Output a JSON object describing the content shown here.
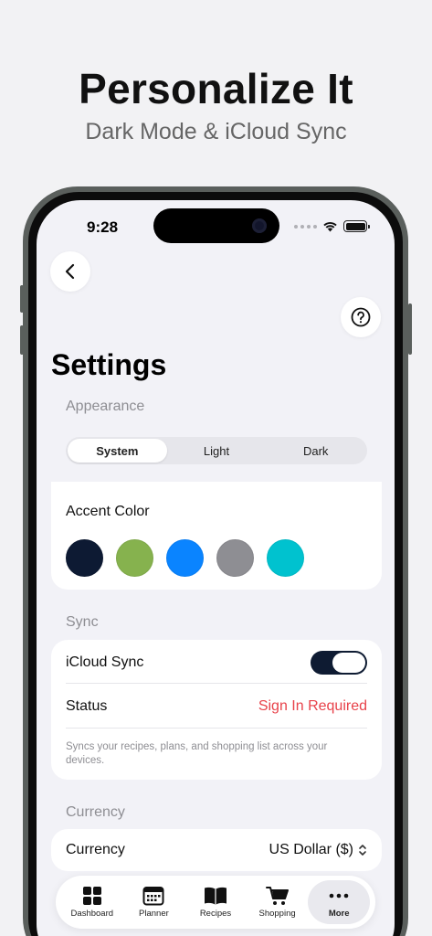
{
  "promo": {
    "title": "Personalize It",
    "subtitle": "Dark Mode & iCloud Sync"
  },
  "status_bar": {
    "time": "9:28"
  },
  "page": {
    "title": "Settings"
  },
  "appearance": {
    "header": "Appearance",
    "options": [
      "System",
      "Light",
      "Dark"
    ],
    "selected": "System"
  },
  "accent": {
    "label": "Accent Color",
    "colors": [
      "#0d1a33",
      "#86b24e",
      "#0a84ff",
      "#8e8e93",
      "#00c2cf"
    ]
  },
  "sync": {
    "header": "Sync",
    "icloud_label": "iCloud Sync",
    "icloud_on": true,
    "status_label": "Status",
    "status_value": "Sign In Required",
    "note": "Syncs your recipes, plans, and shopping list across your devices."
  },
  "currency": {
    "header": "Currency",
    "label": "Currency",
    "value": "US Dollar ($)"
  },
  "tabbar": {
    "items": [
      {
        "label": "Dashboard",
        "icon": "grid-icon"
      },
      {
        "label": "Planner",
        "icon": "calendar-icon"
      },
      {
        "label": "Recipes",
        "icon": "book-icon"
      },
      {
        "label": "Shopping",
        "icon": "cart-icon"
      },
      {
        "label": "More",
        "icon": "ellipsis-icon"
      }
    ],
    "active": "More"
  },
  "colors": {
    "accent_dark": "#0e1b32",
    "warning": "#e8424a",
    "background": "#f2f2f7"
  }
}
